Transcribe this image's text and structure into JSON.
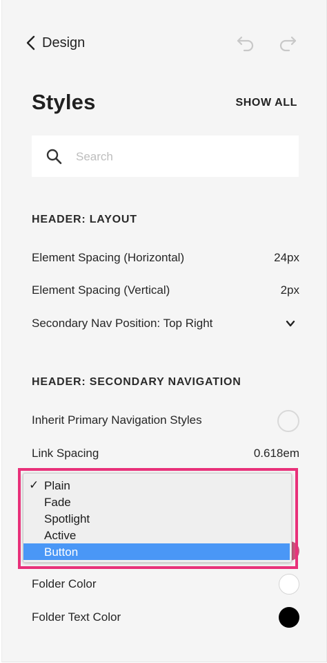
{
  "nav": {
    "back_label": "Design",
    "undo_icon": "undo-icon",
    "redo_icon": "redo-icon"
  },
  "header": {
    "title": "Styles",
    "show_all_label": "SHOW ALL"
  },
  "search": {
    "placeholder": "Search",
    "value": ""
  },
  "sections": {
    "layout_heading": "HEADER: LAYOUT",
    "secondary_heading": "HEADER: SECONDARY NAVIGATION"
  },
  "layout": {
    "element_spacing_h_label": "Element Spacing (Horizontal)",
    "element_spacing_h_value": "24px",
    "element_spacing_v_label": "Element Spacing (Vertical)",
    "element_spacing_v_value": "2px",
    "secondary_nav_position_label": "Secondary Nav Position: Top Right"
  },
  "secondary": {
    "inherit_label": "Inherit Primary Navigation Styles",
    "inherit_on": false,
    "link_spacing_label": "Link Spacing",
    "link_spacing_value": "0.618em",
    "folder_color_label": "Folder Color",
    "folder_color_value": "#ffffff",
    "folder_text_color_label": "Folder Text Color",
    "folder_text_color_value": "#000000"
  },
  "dropdown": {
    "options": [
      {
        "label": "Plain",
        "checked": true
      },
      {
        "label": "Fade",
        "checked": false
      },
      {
        "label": "Spotlight",
        "checked": false
      },
      {
        "label": "Active",
        "checked": false
      },
      {
        "label": "Button",
        "checked": false
      }
    ],
    "checked_mark": "✓",
    "hovered_option": "Button"
  },
  "colors": {
    "highlight_border": "#e8317a",
    "selection_blue": "#4a97f6",
    "background": "#f5f5f5"
  }
}
